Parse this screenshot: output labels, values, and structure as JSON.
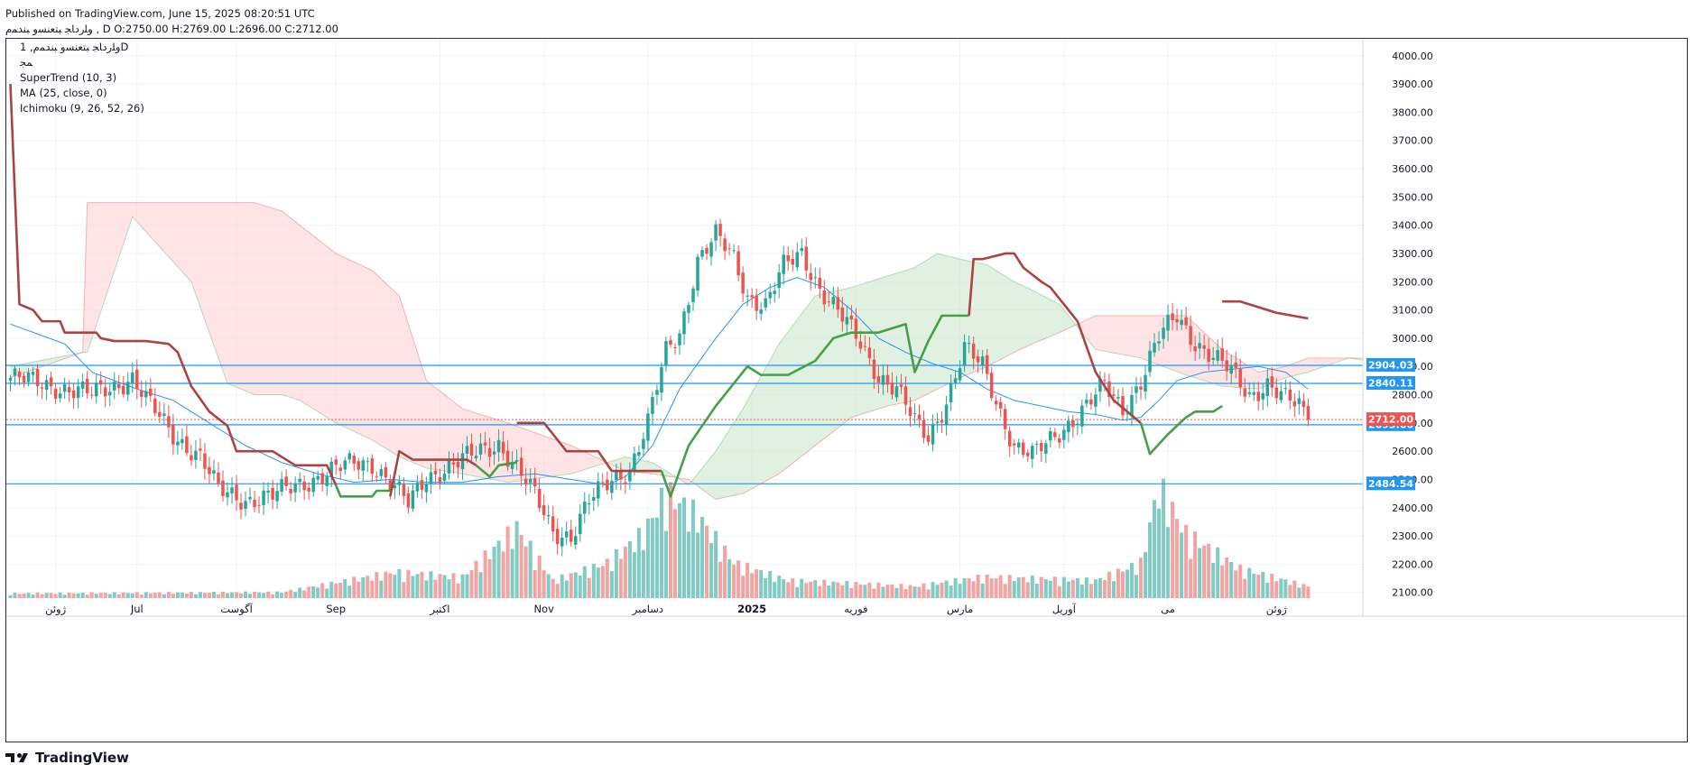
{
  "header": {
    "line1": "Published on TradingView.com, June 15, 2025 08:20:51 UTC",
    "line2": "ﻭﻠﺭﺩﺎﺠ ﺒﺘﻌﻨﺴﻭ ﺒﻨﺪﻤﻡ , D O:2750.00 H:2769.00 L:2696.00 C:2712.00"
  },
  "legend": {
    "symbol": "ﻭﻠﺭﺩﺎﺠ ﺒﺘﻌﻨﺴﻭ ﺒﻨﺪﻤﻡ, 1D",
    "sub": "ﻤﺠ",
    "indicators": [
      "SuperTrend (10, 3)",
      "MA (25, close, 0)",
      "Ichimoku (9, 26, 52, 26)"
    ]
  },
  "brand": {
    "name": "TradingView"
  },
  "colors": {
    "up": "#26a69a",
    "down": "#ef5350",
    "st_up": "#43a047",
    "st_down": "#a94442",
    "ma": "#2196f3",
    "hline": "#2196f3",
    "cloud_bull": "#c8e6c9",
    "cloud_bear": "#ffcdd2",
    "vol_up": "#80cbc4",
    "vol_down": "#f4a3a3",
    "grid": "#f0f3fa"
  },
  "chart_data": {
    "type": "candlestick",
    "title": "ﻭﻠﺭﺩﺎﺠ ﺒﺘﻌﻨﺴﻭ ﺒﻨﺪﻤﻡ, 1D",
    "ylim": [
      2080,
      4060
    ],
    "y_ticks": [
      2100,
      2200,
      2300,
      2400,
      2500,
      2600,
      2700,
      2800,
      2900,
      3000,
      3100,
      3200,
      3300,
      3400,
      3500,
      3600,
      3700,
      3800,
      3900,
      4000
    ],
    "y_tick_labels": [
      "2100.00",
      "2200.00",
      "2300.00",
      "2400.00",
      "2500.00",
      "2600.00",
      "2700.00",
      "2800.00",
      "2900.00",
      "3000.00",
      "3100.00",
      "3200.00",
      "3300.00",
      "3400.00",
      "3500.00",
      "3600.00",
      "3700.00",
      "3800.00",
      "3900.00",
      "4000.00"
    ],
    "x_labels": [
      "ژوئن",
      "Jul",
      "آگوست",
      "Sep",
      "اکتبر",
      "Nov",
      "دسامبر",
      "2025",
      "فوریه",
      "مارس",
      "آوریل",
      "می",
      "ژوئن"
    ],
    "x_label_bar_index": [
      10,
      28,
      50,
      72,
      95,
      118,
      141,
      164,
      187,
      210,
      233,
      256,
      280
    ],
    "last_price": {
      "value": 2712.0,
      "label": "2712.00"
    },
    "horizontal_levels": [
      {
        "value": 2904.03,
        "label": "2904.03"
      },
      {
        "value": 2840.11,
        "label": "2840.11"
      },
      {
        "value": 2693.66,
        "label": "2693.66"
      },
      {
        "value": 2484.54,
        "label": "2484.54"
      }
    ],
    "price_path": [
      [
        0,
        2860
      ],
      [
        10,
        2830
      ],
      [
        18,
        2800
      ],
      [
        27,
        2860
      ],
      [
        30,
        2780
      ],
      [
        36,
        2660
      ],
      [
        42,
        2580
      ],
      [
        46,
        2460
      ],
      [
        52,
        2430
      ],
      [
        58,
        2440
      ],
      [
        63,
        2480
      ],
      [
        70,
        2520
      ],
      [
        76,
        2560
      ],
      [
        80,
        2560
      ],
      [
        85,
        2470
      ],
      [
        88,
        2410
      ],
      [
        92,
        2510
      ],
      [
        99,
        2560
      ],
      [
        104,
        2600
      ],
      [
        108,
        2630
      ],
      [
        112,
        2540
      ],
      [
        116,
        2440
      ],
      [
        120,
        2320
      ],
      [
        124,
        2300
      ],
      [
        128,
        2420
      ],
      [
        133,
        2500
      ],
      [
        137,
        2540
      ],
      [
        141,
        2700
      ],
      [
        145,
        2950
      ],
      [
        148,
        3020
      ],
      [
        152,
        3280
      ],
      [
        156,
        3360
      ],
      [
        160,
        3280
      ],
      [
        163,
        3150
      ],
      [
        167,
        3120
      ],
      [
        171,
        3250
      ],
      [
        175,
        3300
      ],
      [
        179,
        3180
      ],
      [
        184,
        3070
      ],
      [
        188,
        2980
      ],
      [
        192,
        2870
      ],
      [
        196,
        2820
      ],
      [
        200,
        2700
      ],
      [
        203,
        2650
      ],
      [
        207,
        2780
      ],
      [
        211,
        2960
      ],
      [
        215,
        2900
      ],
      [
        218,
        2780
      ],
      [
        222,
        2620
      ],
      [
        226,
        2580
      ],
      [
        230,
        2640
      ],
      [
        234,
        2700
      ],
      [
        238,
        2760
      ],
      [
        242,
        2830
      ],
      [
        246,
        2750
      ],
      [
        250,
        2850
      ],
      [
        254,
        3000
      ],
      [
        258,
        3080
      ],
      [
        262,
        2990
      ],
      [
        266,
        2930
      ],
      [
        270,
        2880
      ],
      [
        274,
        2800
      ],
      [
        278,
        2840
      ],
      [
        282,
        2780
      ],
      [
        285,
        2760
      ],
      [
        287,
        2712
      ]
    ],
    "volume_path": [
      [
        0,
        0.04
      ],
      [
        60,
        0.05
      ],
      [
        85,
        0.22
      ],
      [
        100,
        0.18
      ],
      [
        112,
        0.6
      ],
      [
        120,
        0.15
      ],
      [
        132,
        0.3
      ],
      [
        140,
        0.55
      ],
      [
        145,
        0.9
      ],
      [
        152,
        0.7
      ],
      [
        160,
        0.3
      ],
      [
        172,
        0.15
      ],
      [
        200,
        0.1
      ],
      [
        215,
        0.18
      ],
      [
        240,
        0.15
      ],
      [
        250,
        0.3
      ],
      [
        254,
        0.95
      ],
      [
        260,
        0.55
      ],
      [
        272,
        0.25
      ],
      [
        287,
        0.1
      ]
    ],
    "ma_path": [
      [
        0,
        3050
      ],
      [
        12,
        2980
      ],
      [
        18,
        2880
      ],
      [
        28,
        2820
      ],
      [
        36,
        2780
      ],
      [
        44,
        2700
      ],
      [
        52,
        2620
      ],
      [
        60,
        2560
      ],
      [
        68,
        2520
      ],
      [
        76,
        2490
      ],
      [
        84,
        2500
      ],
      [
        92,
        2490
      ],
      [
        100,
        2490
      ],
      [
        108,
        2510
      ],
      [
        116,
        2520
      ],
      [
        124,
        2500
      ],
      [
        132,
        2480
      ],
      [
        136,
        2510
      ],
      [
        142,
        2620
      ],
      [
        148,
        2820
      ],
      [
        156,
        3000
      ],
      [
        162,
        3120
      ],
      [
        168,
        3180
      ],
      [
        174,
        3215
      ],
      [
        180,
        3180
      ],
      [
        186,
        3100
      ],
      [
        192,
        3000
      ],
      [
        198,
        2950
      ],
      [
        204,
        2910
      ],
      [
        210,
        2880
      ],
      [
        216,
        2820
      ],
      [
        222,
        2780
      ],
      [
        228,
        2760
      ],
      [
        234,
        2740
      ],
      [
        240,
        2730
      ],
      [
        246,
        2710
      ],
      [
        250,
        2720
      ],
      [
        254,
        2780
      ],
      [
        258,
        2850
      ],
      [
        264,
        2880
      ],
      [
        270,
        2890
      ],
      [
        276,
        2900
      ],
      [
        282,
        2880
      ],
      [
        287,
        2820
      ]
    ],
    "supertrend": [
      {
        "trend": "down",
        "points": [
          [
            0,
            3900
          ],
          [
            2,
            3120
          ],
          [
            5,
            3100
          ],
          [
            7,
            3060
          ],
          [
            11,
            3060
          ],
          [
            12,
            3020
          ],
          [
            19,
            3020
          ],
          [
            20,
            3000
          ],
          [
            23,
            2990
          ],
          [
            30,
            2990
          ],
          [
            35,
            2980
          ],
          [
            37,
            2950
          ],
          [
            40,
            2830
          ],
          [
            44,
            2740
          ],
          [
            48,
            2690
          ],
          [
            50,
            2600
          ],
          [
            58,
            2600
          ],
          [
            60,
            2580
          ],
          [
            63,
            2550
          ],
          [
            70,
            2550
          ],
          [
            72,
            2480
          ]
        ]
      },
      {
        "trend": "up",
        "points": [
          [
            72,
            2480
          ],
          [
            73,
            2440
          ],
          [
            80,
            2440
          ],
          [
            81,
            2460
          ],
          [
            84,
            2460
          ]
        ]
      },
      {
        "trend": "down",
        "points": [
          [
            84,
            2440
          ],
          [
            86,
            2600
          ],
          [
            89,
            2570
          ],
          [
            101,
            2570
          ],
          [
            103,
            2550
          ]
        ]
      },
      {
        "trend": "up",
        "points": [
          [
            103,
            2550
          ],
          [
            106,
            2510
          ],
          [
            108,
            2550
          ],
          [
            112,
            2560
          ]
        ]
      },
      {
        "trend": "down",
        "points": [
          [
            112,
            2700
          ],
          [
            118,
            2700
          ],
          [
            123,
            2600
          ],
          [
            130,
            2600
          ],
          [
            133,
            2530
          ],
          [
            144,
            2530
          ]
        ]
      },
      {
        "trend": "up",
        "points": [
          [
            144,
            2530
          ],
          [
            146,
            2440
          ],
          [
            150,
            2620
          ],
          [
            156,
            2760
          ],
          [
            163,
            2900
          ],
          [
            166,
            2870
          ],
          [
            172,
            2870
          ],
          [
            178,
            2920
          ],
          [
            182,
            3000
          ],
          [
            186,
            3020
          ],
          [
            192,
            3020
          ],
          [
            198,
            3050
          ],
          [
            200,
            2880
          ],
          [
            203,
            2990
          ],
          [
            206,
            3080
          ],
          [
            210,
            3080
          ],
          [
            212,
            3080
          ]
        ]
      },
      {
        "trend": "down",
        "points": [
          [
            212,
            3080
          ],
          [
            213,
            3280
          ],
          [
            215,
            3280
          ],
          [
            220,
            3300
          ],
          [
            222,
            3300
          ],
          [
            224,
            3250
          ],
          [
            228,
            3200
          ],
          [
            230,
            3180
          ],
          [
            236,
            3060
          ],
          [
            240,
            2880
          ],
          [
            244,
            2780
          ],
          [
            250,
            2700
          ]
        ]
      },
      {
        "trend": "up",
        "points": [
          [
            250,
            2700
          ],
          [
            252,
            2590
          ],
          [
            256,
            2660
          ],
          [
            260,
            2720
          ],
          [
            262,
            2740
          ],
          [
            266,
            2740
          ],
          [
            268,
            2760
          ]
        ]
      },
      {
        "trend": "down",
        "points": [
          [
            268,
            3130
          ],
          [
            272,
            3130
          ],
          [
            276,
            3110
          ],
          [
            280,
            3090
          ],
          [
            287,
            3070
          ]
        ]
      }
    ],
    "cloud": [
      [
        0,
        2860,
        2900
      ],
      [
        16,
        2950,
        2950
      ],
      [
        17,
        3480,
        2950
      ],
      [
        27,
        3480,
        3430
      ],
      [
        40,
        3480,
        3200
      ],
      [
        48,
        3480,
        2840
      ],
      [
        54,
        3480,
        2800
      ],
      [
        60,
        3450,
        2800
      ],
      [
        64,
        3400,
        2780
      ],
      [
        72,
        3300,
        2700
      ],
      [
        80,
        3240,
        2640
      ],
      [
        86,
        3150,
        2580
      ],
      [
        92,
        2850,
        2540
      ],
      [
        100,
        2750,
        2520
      ],
      [
        110,
        2700,
        2490
      ],
      [
        124,
        2620,
        2520
      ],
      [
        136,
        2530,
        2580
      ],
      [
        142,
        2520,
        2560
      ],
      [
        150,
        2500,
        2480
      ],
      [
        156,
        2430,
        2600
      ],
      [
        162,
        2450,
        2750
      ],
      [
        170,
        2520,
        2980
      ],
      [
        178,
        2620,
        3150
      ],
      [
        186,
        2720,
        3180
      ],
      [
        194,
        2760,
        3220
      ],
      [
        200,
        2780,
        3250
      ],
      [
        205,
        2820,
        3300
      ],
      [
        210,
        2860,
        3280
      ],
      [
        216,
        2900,
        3260
      ],
      [
        222,
        2950,
        3200
      ],
      [
        226,
        2980,
        3170
      ],
      [
        232,
        3020,
        3120
      ],
      [
        240,
        3080,
        2960
      ],
      [
        250,
        3080,
        2930
      ],
      [
        260,
        3080,
        2870
      ],
      [
        268,
        2960,
        2830
      ],
      [
        276,
        2880,
        2820
      ],
      [
        282,
        2900,
        2860
      ],
      [
        287,
        2930,
        2880
      ],
      [
        296,
        2930,
        2930
      ],
      [
        300,
        2920,
        2930
      ]
    ]
  }
}
